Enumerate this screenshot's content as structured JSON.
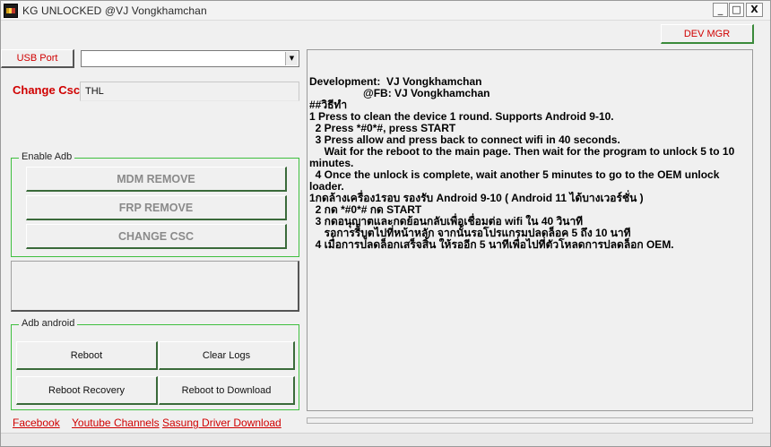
{
  "window": {
    "title": "KG UNLOCKED @VJ Vongkhamchan",
    "minimize": "_",
    "maximize": "□",
    "close": "X"
  },
  "toolbar": {
    "dev_mgr_label": "DEV MGR",
    "usb_port_label": "USB Port",
    "usb_port_value": "",
    "combo_arrow": "▼"
  },
  "csc": {
    "label": "Change Csc:",
    "value": "THL"
  },
  "enable_adb": {
    "legend": "Enable Adb",
    "buttons": [
      "MDM REMOVE",
      "FRP REMOVE",
      "CHANGE CSC"
    ]
  },
  "adb_android": {
    "legend": "Adb android",
    "reboot": "Reboot",
    "clear_logs": "Clear Logs",
    "reboot_recovery": "Reboot Recovery",
    "reboot_download": "Reboot to Download"
  },
  "info_lines": [
    "Development:  VJ Vongkhamchan",
    "                  @FB: VJ Vongkhamchan",
    "##วิธีทำ",
    "1 Press to clean the device 1 round. Supports Android 9-10.",
    "  2 Press *#0*#, press START",
    "",
    "  3 Press allow and press back to connect wifi in 40 seconds.",
    "     Wait for the reboot to the main page. Then wait for the program to unlock 5 to 10",
    "minutes.",
    "",
    "  4 Once the unlock is complete, wait another 5 minutes to go to the OEM unlock",
    "loader.",
    "",
    "1กดล้างเครื่อง1รอบ รองรับ Android 9-10 ( Android 11 ได้บางเวอร์ชั่น )",
    "  2 กด *#0*# กด START",
    "",
    "  3 กดอนุญาตและกดย้อนกลับเพื่อเชื่อมต่อ wifi ใน 40 วินาที",
    "     รอการรีบูตไปที่หน้าหลัก จากนั้นรอโปรแกรมปลดล็อค 5 ถึง 10 นาที",
    "",
    "  4 เมื่อการปลดล็อกเสร็จสิ้น ให้รออีก 5 นาทีเพื่อไปที่ตัวโหลดการปลดล็อก OEM."
  ],
  "links": {
    "facebook": "Facebook",
    "youtube": "Youtube Channels",
    "samsung_driver": "Sasung Driver Download"
  },
  "colors": {
    "accent_red": "#d00000",
    "group_border_green": "#3fbf3f"
  }
}
